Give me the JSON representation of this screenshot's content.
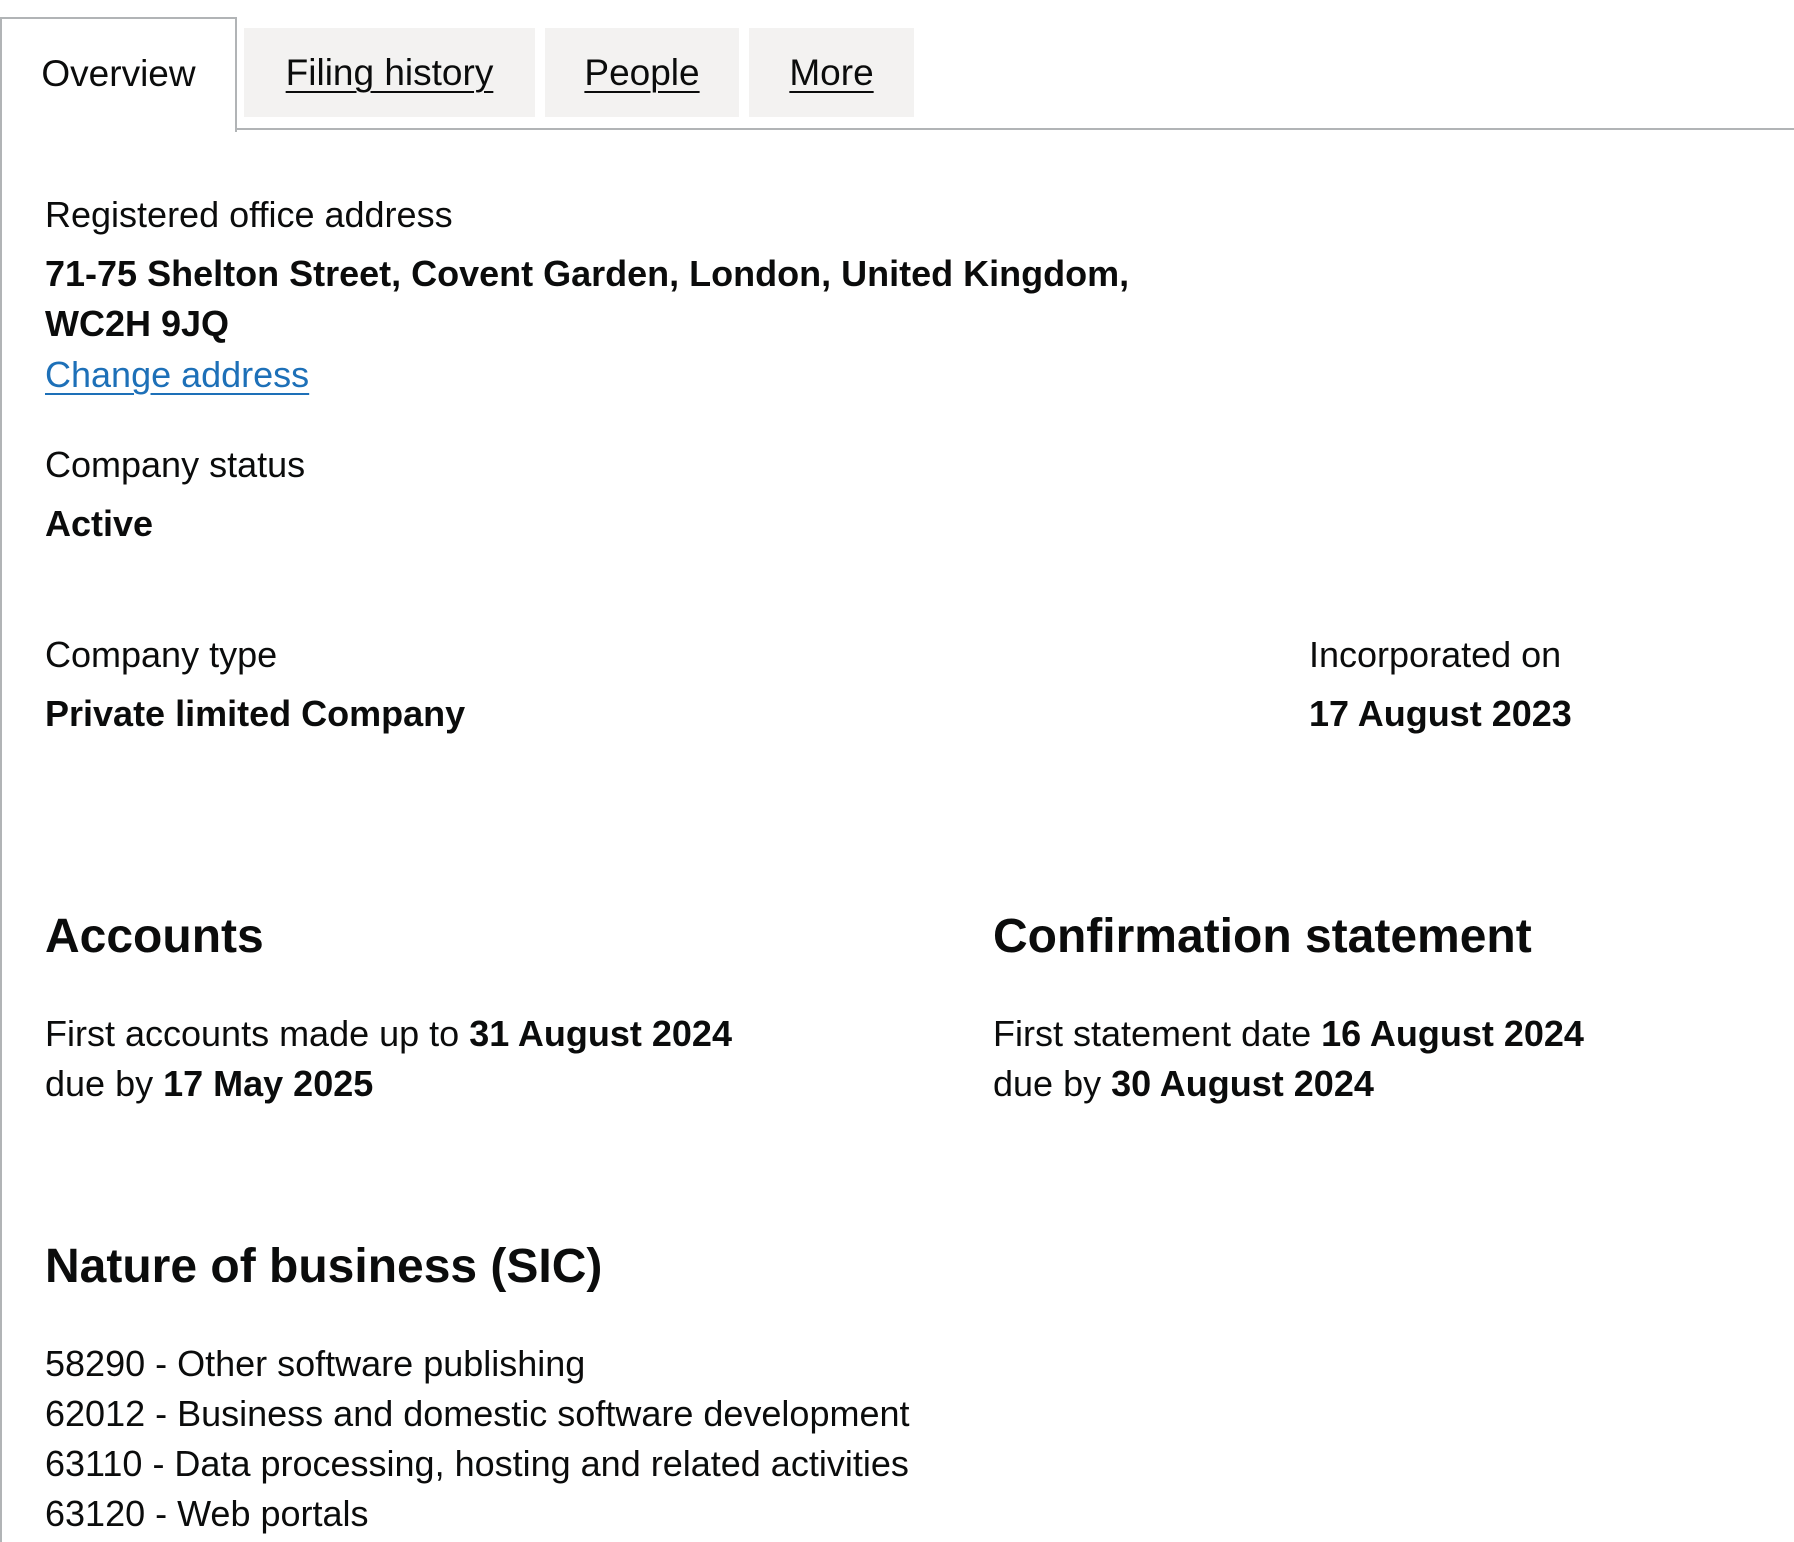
{
  "tabs": [
    {
      "label": "Overview",
      "active": true
    },
    {
      "label": "Filing history",
      "active": false
    },
    {
      "label": "People",
      "active": false
    },
    {
      "label": "More",
      "active": false
    }
  ],
  "registered_office": {
    "label": "Registered office address",
    "address_line_1": "71-75 Shelton Street, Covent Garden, London, United Kingdom,",
    "address_line_2": "WC2H 9JQ",
    "change_link": "Change address"
  },
  "company_status": {
    "label": "Company status",
    "value": "Active"
  },
  "company_type": {
    "label": "Company type",
    "value": "Private limited Company"
  },
  "incorporated": {
    "label": "Incorporated on",
    "value": "17 August 2023"
  },
  "accounts": {
    "heading": "Accounts",
    "line1_prefix": "First accounts made up to ",
    "line1_date": "31 August 2024",
    "line2_prefix": "due by ",
    "line2_date": "17 May 2025"
  },
  "confirmation": {
    "heading": "Confirmation statement",
    "line1_prefix": "First statement date ",
    "line1_date": "16 August 2024",
    "line2_prefix": "due by ",
    "line2_date": "30 August 2024"
  },
  "sic": {
    "heading": "Nature of business (SIC)",
    "items": [
      "58290 - Other software publishing",
      "62012 - Business and domestic software development",
      "63110 - Data processing, hosting and related activities",
      "63120 - Web portals"
    ]
  },
  "colors": {
    "link": "#1d70b8",
    "text": "#0b0c0c",
    "tab_bg": "#f3f2f1",
    "border": "#b1b4b6"
  }
}
